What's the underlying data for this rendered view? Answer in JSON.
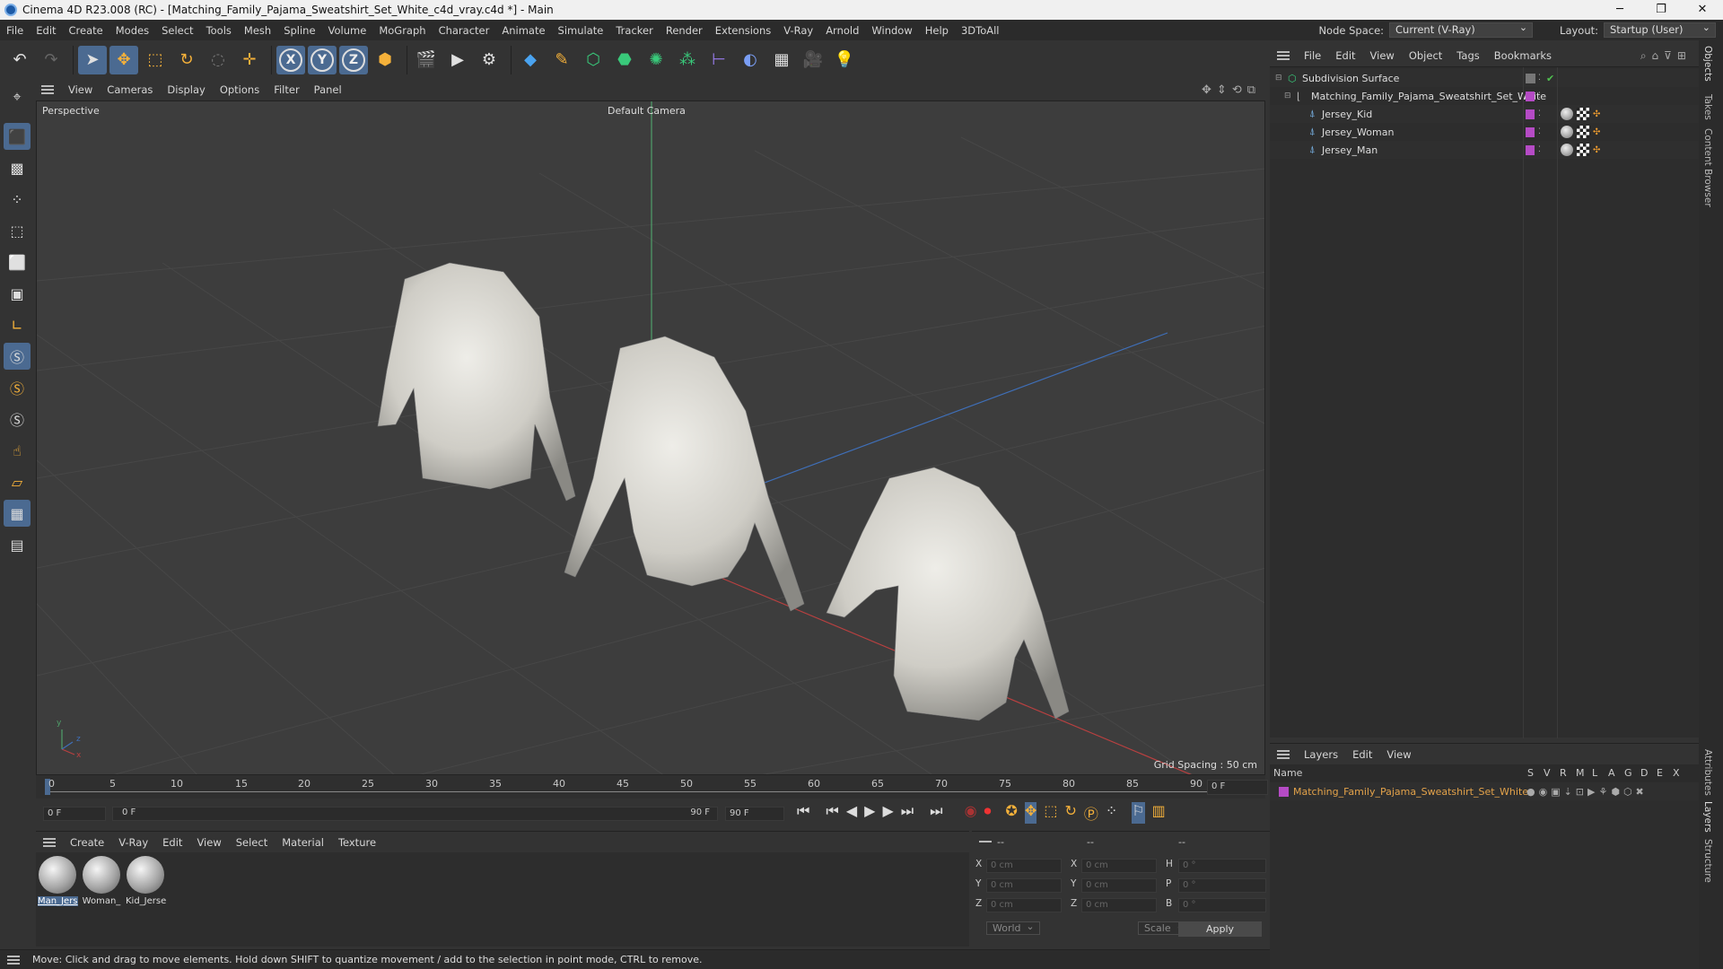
{
  "window": {
    "title": "Cinema 4D R23.008 (RC) - [Matching_Family_Pajama_Sweatshirt_Set_White_c4d_vray.c4d *] - Main",
    "minimize": "─",
    "maximize": "❐",
    "close": "✕"
  },
  "menubar": {
    "items": [
      "File",
      "Edit",
      "Create",
      "Modes",
      "Select",
      "Tools",
      "Mesh",
      "Spline",
      "Volume",
      "MoGraph",
      "Character",
      "Animate",
      "Simulate",
      "Tracker",
      "Render",
      "Extensions",
      "V-Ray",
      "Arnold",
      "Window",
      "Help",
      "3DToAll"
    ],
    "node_space_label": "Node Space:",
    "node_space_value": "Current (V-Ray)",
    "layout_label": "Layout:",
    "layout_value": "Startup (User)"
  },
  "toolbar": {
    "axis_x": "X",
    "axis_y": "Y",
    "axis_z": "Z"
  },
  "viewport": {
    "menu": [
      "View",
      "Cameras",
      "Display",
      "Options",
      "Filter",
      "Panel"
    ],
    "view_name": "Perspective",
    "camera": "Default Camera",
    "grid_spacing": "Grid Spacing : 50 cm",
    "axis_x": "x",
    "axis_y": "y",
    "axis_z": "z"
  },
  "timeline": {
    "ticks": [
      "0",
      "5",
      "10",
      "15",
      "20",
      "25",
      "30",
      "35",
      "40",
      "45",
      "50",
      "55",
      "60",
      "65",
      "70",
      "75",
      "80",
      "85",
      "90"
    ],
    "current_frame": "0 F",
    "start_field": "0 F",
    "range_start": "0 F",
    "range_end": "90 F",
    "end_field": "90 F"
  },
  "material_manager": {
    "menu": [
      "Create",
      "V-Ray",
      "Edit",
      "View",
      "Select",
      "Material",
      "Texture"
    ],
    "materials": [
      {
        "label": "Man_Jers",
        "selected": true
      },
      {
        "label": "Woman_",
        "selected": false
      },
      {
        "label": "Kid_Jerse",
        "selected": false
      }
    ]
  },
  "coordinates": {
    "headers": [
      "--",
      "--",
      "--"
    ],
    "rows": [
      {
        "a": "X",
        "a_val": "0 cm",
        "b": "X",
        "b_val": "0 cm",
        "c": "H",
        "c_val": "0 °"
      },
      {
        "a": "Y",
        "a_val": "0 cm",
        "b": "Y",
        "b_val": "0 cm",
        "c": "P",
        "c_val": "0 °"
      },
      {
        "a": "Z",
        "a_val": "0 cm",
        "b": "Z",
        "b_val": "0 cm",
        "c": "B",
        "c_val": "0 °"
      }
    ],
    "space": "World",
    "mode": "Scale",
    "apply": "Apply"
  },
  "statusbar": {
    "text": "Move: Click and drag to move elements. Hold down SHIFT to quantize movement / add to the selection in point mode, CTRL to remove."
  },
  "objects": {
    "menu": [
      "File",
      "Edit",
      "View",
      "Object",
      "Tags",
      "Bookmarks"
    ],
    "items": [
      {
        "name": "Subdivision Surface",
        "level": 0
      },
      {
        "name": "Matching_Family_Pajama_Sweatshirt_Set_White",
        "level": 1
      },
      {
        "name": "Jersey_Kid",
        "level": 2
      },
      {
        "name": "Jersey_Woman",
        "level": 2
      },
      {
        "name": "Jersey_Man",
        "level": 2
      }
    ]
  },
  "layers": {
    "menu": [
      "Layers",
      "Edit",
      "View"
    ],
    "name_header": "Name",
    "columns": [
      "S",
      "V",
      "R",
      "M",
      "L",
      "A",
      "G",
      "D",
      "E",
      "X"
    ],
    "items": [
      {
        "name": "Matching_Family_Pajama_Sweatshirt_Set_White",
        "color": "#b54bc5"
      }
    ]
  },
  "side_tabs": [
    "Objects",
    "Takes",
    "Content Browser",
    "Attributes",
    "Layers",
    "Structure"
  ],
  "colors": {
    "accent": "#4b6a91",
    "layer": "#b54bc5",
    "layer_text": "#e3a24a"
  }
}
